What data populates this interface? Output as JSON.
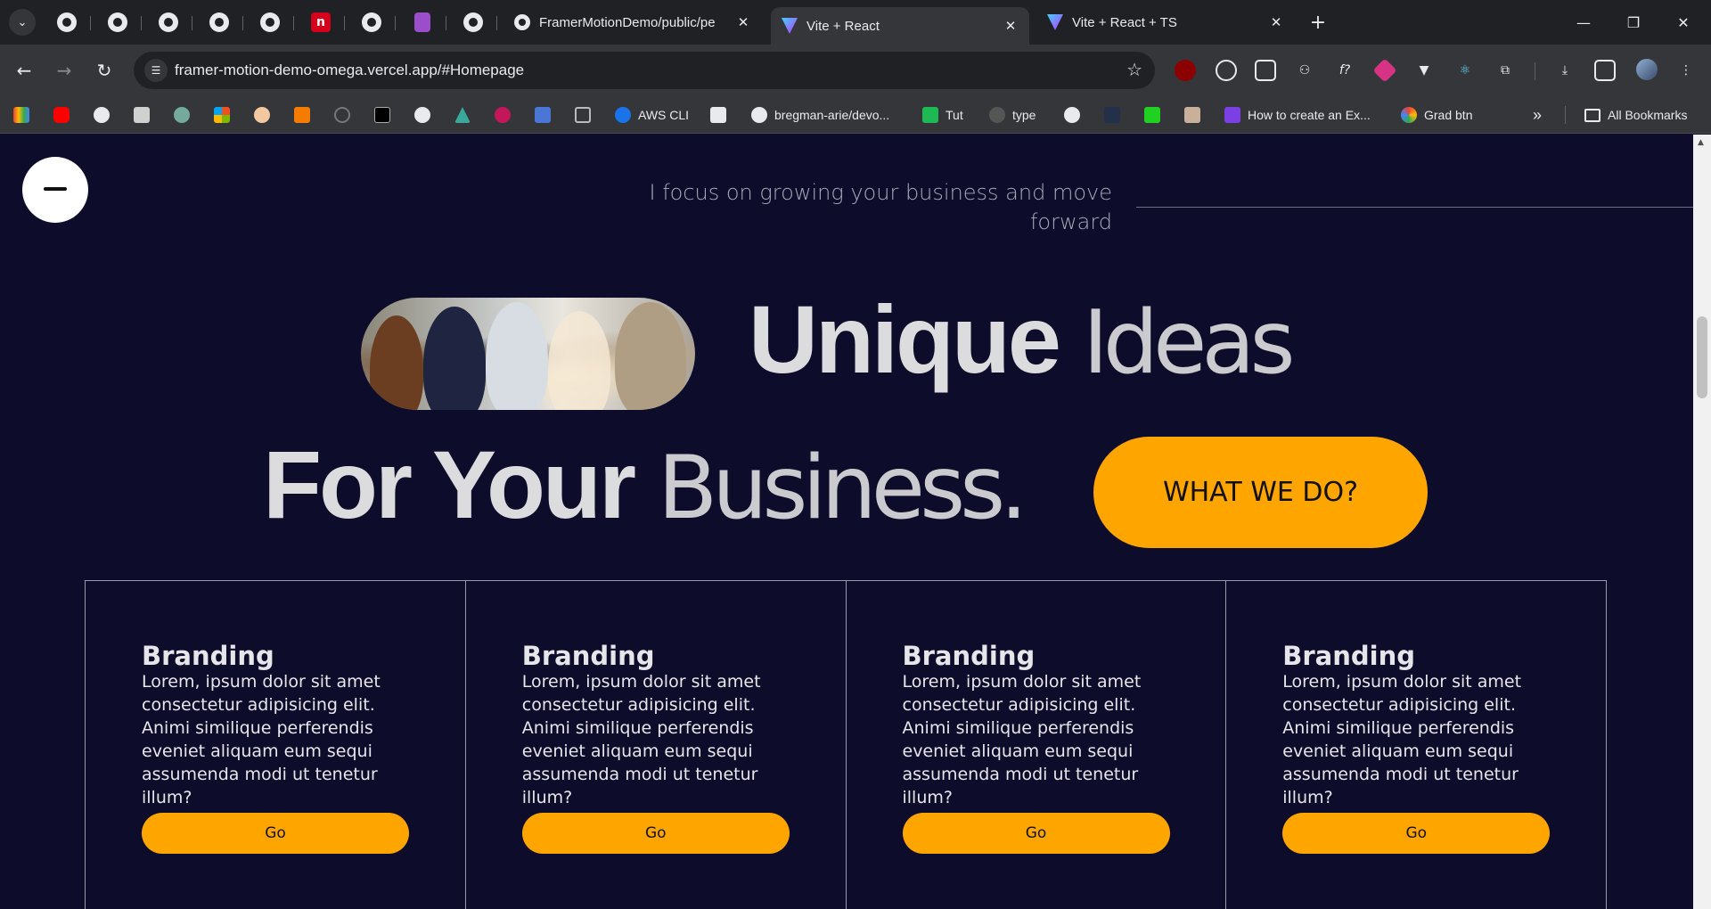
{
  "browser": {
    "tabs": [
      {
        "title": "FramerMotionDemo/public/pe",
        "favicon": "github-icon",
        "active": false
      },
      {
        "title": "Vite + React",
        "favicon": "vite-icon",
        "active": true
      },
      {
        "title": "Vite + React + TS",
        "favicon": "vite-icon",
        "active": false
      }
    ],
    "new_tab": "+",
    "address": "framer-motion-demo-omega.vercel.app/#Homepage",
    "bookmarks": [
      {
        "label": "AWS CLI",
        "icon": "aws-icon"
      },
      {
        "label": "bregman-arie/devo...",
        "icon": "github-icon"
      },
      {
        "label": "Tut",
        "icon": "framer-icon"
      },
      {
        "label": "type",
        "icon": "github-icon"
      },
      {
        "label": "How to create an Ex...",
        "icon": "bookmark-icon"
      },
      {
        "label": "Grad btn",
        "icon": "bookmark-icon"
      }
    ],
    "overflow": "»",
    "all_bookmarks": "All Bookmarks"
  },
  "page": {
    "tagline": "I focus on growing your business and move forward",
    "headline": {
      "line1_bold": "Unique",
      "line1_thin": "Ideas",
      "line2_bold": "For Your",
      "line2_thin": "Business."
    },
    "cta_label": "WHAT WE DO?",
    "cards": [
      {
        "title": "Branding",
        "body": "Lorem, ipsum dolor sit amet consectetur adipisicing elit. Animi similique perferendis eveniet aliquam eum sequi assumenda modi ut tenetur illum?",
        "button": "Go"
      },
      {
        "title": "Branding",
        "body": "Lorem, ipsum dolor sit amet consectetur adipisicing elit. Animi similique perferendis eveniet aliquam eum sequi assumenda modi ut tenetur illum?",
        "button": "Go"
      },
      {
        "title": "Branding",
        "body": "Lorem, ipsum dolor sit amet consectetur adipisicing elit. Animi similique perferendis eveniet aliquam eum sequi assumenda modi ut tenetur illum?",
        "button": "Go"
      },
      {
        "title": "Branding",
        "body": "Lorem, ipsum dolor sit amet consectetur adipisicing elit. Animi similique perferendis eveniet aliquam eum sequi assumenda modi ut tenetur illum?",
        "button": "Go"
      }
    ]
  },
  "colors": {
    "page_bg": "#0d0c2a",
    "accent": "#ffa500",
    "text": "#dcdcde"
  }
}
